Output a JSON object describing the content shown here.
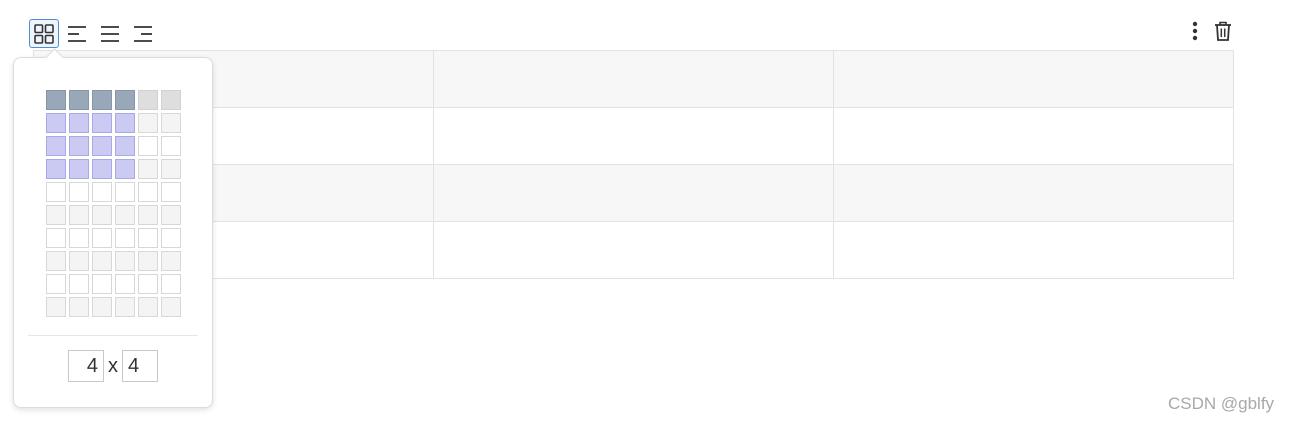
{
  "toolbar": {
    "left_icons": [
      "table-size-icon",
      "align-left-icon",
      "align-center-icon",
      "align-right-icon"
    ],
    "active_icon": "table-size-icon",
    "right_icons": [
      "more-vertical-icon",
      "trash-icon"
    ]
  },
  "table": {
    "rows": 4,
    "columns": 3,
    "cells": [
      [
        "",
        "",
        ""
      ],
      [
        "",
        "",
        ""
      ],
      [
        "",
        "",
        ""
      ],
      [
        "",
        "",
        ""
      ]
    ]
  },
  "size_picker": {
    "grid_rows": 10,
    "grid_columns": 6,
    "selected_rows": 4,
    "selected_columns": 4,
    "rows_value": "4",
    "separator": "x",
    "columns_value": "4"
  },
  "colors": {
    "active_border": "#4a90d9",
    "selected_cell": "#cacaf3",
    "header_selected_cell": "#98a8b8"
  },
  "watermark": "CSDN @gblfy"
}
